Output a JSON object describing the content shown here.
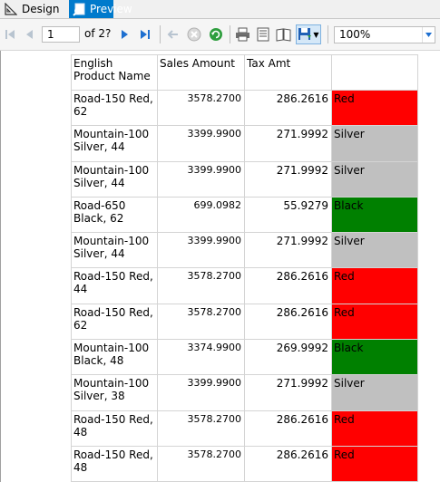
{
  "tabs": [
    {
      "label": "Design",
      "icon": "design-icon"
    },
    {
      "label": "Preview",
      "icon": "preview-icon",
      "active": true
    }
  ],
  "toolbar": {
    "page_current": "1",
    "page_of": "of  2?",
    "zoom": "100%"
  },
  "report": {
    "headers": [
      "English Product Name",
      "Sales Amount",
      "Tax Amt",
      ""
    ],
    "colors": {
      "Red": "#ff0000",
      "Silver": "#c0c0c0",
      "Black": "#008000"
    },
    "rows": [
      {
        "name": "Road-150 Red, 62",
        "sales": "3578.2700",
        "tax": "286.2616",
        "color": "Red"
      },
      {
        "name": "Mountain-100 Silver, 44",
        "sales": "3399.9900",
        "tax": "271.9992",
        "color": "Silver"
      },
      {
        "name": "Mountain-100 Silver, 44",
        "sales": "3399.9900",
        "tax": "271.9992",
        "color": "Silver"
      },
      {
        "name": "Road-650 Black, 62",
        "sales": "699.0982",
        "tax": "55.9279",
        "color": "Black"
      },
      {
        "name": "Mountain-100 Silver, 44",
        "sales": "3399.9900",
        "tax": "271.9992",
        "color": "Silver"
      },
      {
        "name": "Road-150 Red, 44",
        "sales": "3578.2700",
        "tax": "286.2616",
        "color": "Red"
      },
      {
        "name": "Road-150 Red, 62",
        "sales": "3578.2700",
        "tax": "286.2616",
        "color": "Red"
      },
      {
        "name": "Mountain-100 Black, 48",
        "sales": "3374.9900",
        "tax": "269.9992",
        "color": "Black"
      },
      {
        "name": "Mountain-100 Silver, 38",
        "sales": "3399.9900",
        "tax": "271.9992",
        "color": "Silver"
      },
      {
        "name": "Road-150 Red, 48",
        "sales": "3578.2700",
        "tax": "286.2616",
        "color": "Red"
      },
      {
        "name": "Road-150 Red, 48",
        "sales": "3578.2700",
        "tax": "286.2616",
        "color": "Red"
      }
    ]
  }
}
